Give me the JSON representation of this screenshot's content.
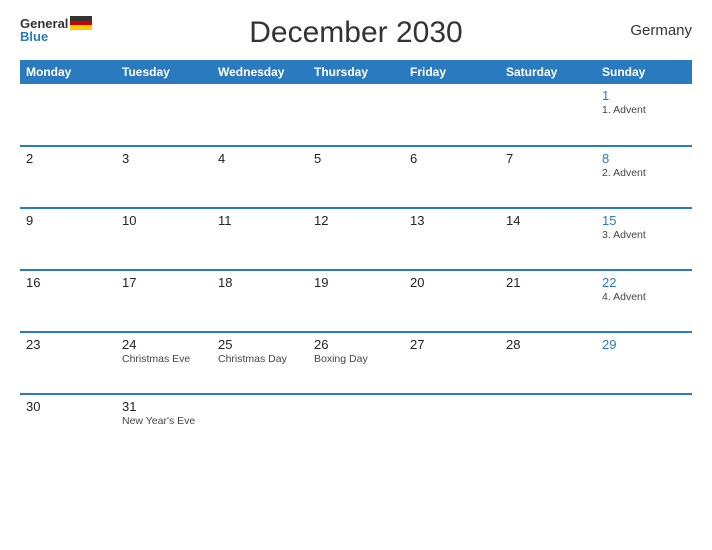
{
  "header": {
    "title": "December 2030",
    "country": "Germany",
    "logo_general": "General",
    "logo_blue": "Blue"
  },
  "columns": [
    "Monday",
    "Tuesday",
    "Wednesday",
    "Thursday",
    "Friday",
    "Saturday",
    "Sunday"
  ],
  "weeks": [
    [
      {
        "num": "",
        "event": ""
      },
      {
        "num": "",
        "event": ""
      },
      {
        "num": "",
        "event": ""
      },
      {
        "num": "",
        "event": ""
      },
      {
        "num": "",
        "event": ""
      },
      {
        "num": "",
        "event": ""
      },
      {
        "num": "1",
        "event": "1. Advent"
      }
    ],
    [
      {
        "num": "2",
        "event": ""
      },
      {
        "num": "3",
        "event": ""
      },
      {
        "num": "4",
        "event": ""
      },
      {
        "num": "5",
        "event": ""
      },
      {
        "num": "6",
        "event": ""
      },
      {
        "num": "7",
        "event": ""
      },
      {
        "num": "8",
        "event": "2. Advent"
      }
    ],
    [
      {
        "num": "9",
        "event": ""
      },
      {
        "num": "10",
        "event": ""
      },
      {
        "num": "11",
        "event": ""
      },
      {
        "num": "12",
        "event": ""
      },
      {
        "num": "13",
        "event": ""
      },
      {
        "num": "14",
        "event": ""
      },
      {
        "num": "15",
        "event": "3. Advent"
      }
    ],
    [
      {
        "num": "16",
        "event": ""
      },
      {
        "num": "17",
        "event": ""
      },
      {
        "num": "18",
        "event": ""
      },
      {
        "num": "19",
        "event": ""
      },
      {
        "num": "20",
        "event": ""
      },
      {
        "num": "21",
        "event": ""
      },
      {
        "num": "22",
        "event": "4. Advent"
      }
    ],
    [
      {
        "num": "23",
        "event": ""
      },
      {
        "num": "24",
        "event": "Christmas Eve"
      },
      {
        "num": "25",
        "event": "Christmas Day"
      },
      {
        "num": "26",
        "event": "Boxing Day"
      },
      {
        "num": "27",
        "event": ""
      },
      {
        "num": "28",
        "event": ""
      },
      {
        "num": "29",
        "event": ""
      }
    ],
    [
      {
        "num": "30",
        "event": ""
      },
      {
        "num": "31",
        "event": "New Year's Eve"
      },
      {
        "num": "",
        "event": ""
      },
      {
        "num": "",
        "event": ""
      },
      {
        "num": "",
        "event": ""
      },
      {
        "num": "",
        "event": ""
      },
      {
        "num": "",
        "event": ""
      }
    ]
  ]
}
